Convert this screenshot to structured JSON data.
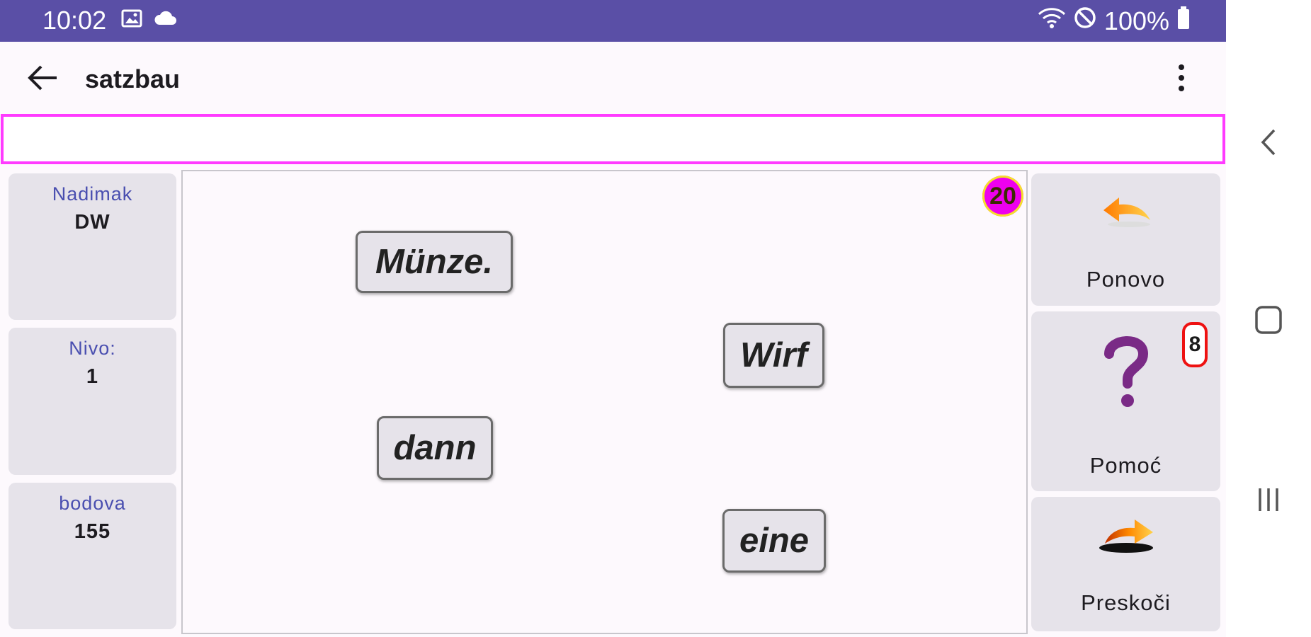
{
  "status_bar": {
    "time": "10:02",
    "battery": "100%",
    "icons": [
      "image-icon",
      "cloud-icon",
      "wifi-icon",
      "do-not-disturb-icon",
      "battery-icon"
    ]
  },
  "toolbar": {
    "title": "satzbau"
  },
  "answer": {
    "text": ""
  },
  "stats": {
    "nickname_label": "Nadimak",
    "nickname_value": "DW",
    "level_label": "Nivo:",
    "level_value": "1",
    "points_label": "bodova",
    "points_value": "155"
  },
  "board": {
    "counter": "20",
    "words": [
      "Münze.",
      "Wirf",
      "dann",
      "eine"
    ]
  },
  "actions": {
    "repeat_label": "Ponovo",
    "help_label": "Pomoć",
    "help_count": "8",
    "skip_label": "Preskoči"
  },
  "colors": {
    "status_bar": "#5a4fa6",
    "answer_border": "#ff3bff",
    "counter_bg": "#ee00ee",
    "help_badge_border": "#ee1111",
    "question_mark": "#7a2a86"
  }
}
